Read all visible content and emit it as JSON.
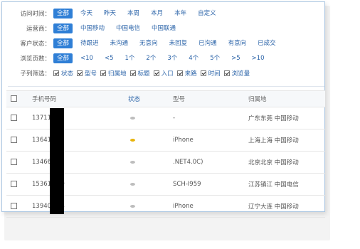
{
  "filters": {
    "visit_time": {
      "label": "访问时间：",
      "options": [
        "全部",
        "今天",
        "昨天",
        "本周",
        "本月",
        "本年",
        "自定义"
      ]
    },
    "carrier": {
      "label": "运营商：",
      "options": [
        "全部",
        "中国移动",
        "中国电信",
        "中国联通"
      ]
    },
    "customer_status": {
      "label": "客户状态：",
      "options": [
        "全部",
        "待跟进",
        "未沟通",
        "无意向",
        "未回复",
        "已沟通",
        "有意向",
        "已成交"
      ]
    },
    "pages_viewed": {
      "label": "浏览页数：",
      "options": [
        "全部",
        "<10",
        "<5",
        "1个",
        "2个",
        "3个",
        "4个",
        "5个",
        ">5",
        ">10"
      ]
    },
    "sub_columns": {
      "label": "子列筛选：",
      "items": [
        "状态",
        "型号",
        "归属地",
        "标题",
        "入口",
        "来路",
        "时间",
        "浏览量"
      ]
    }
  },
  "table": {
    "headers": [
      "",
      "手机号码",
      "状态",
      "型号",
      "归属地"
    ],
    "rows": [
      {
        "phone": "13711    692",
        "status_color": "#bdbdbd",
        "model": "-",
        "location": "广东东莞 中国移动"
      },
      {
        "phone": "13641    582",
        "status_color": "#e8b40c",
        "model": "iPhone",
        "location": "上海上海 中国移动"
      },
      {
        "phone": "13466    445",
        "status_color": "#bdbdbd",
        "model": ".NET4.0C)",
        "location": "北京北京 中国移动"
      },
      {
        "phone": "15361    689",
        "status_color": "#bdbdbd",
        "model": "SCH-I959",
        "location": "江苏镇江 中国电信"
      },
      {
        "phone": "13940    734",
        "status_color": "#bdbdbd",
        "model": "iPhone",
        "location": "辽宁大连 中国移动"
      }
    ]
  },
  "colors": {
    "accent": "#2f7fd6",
    "link": "#2a63a8",
    "status_active": "#e8b40c",
    "status_inactive": "#bdbdbd"
  }
}
